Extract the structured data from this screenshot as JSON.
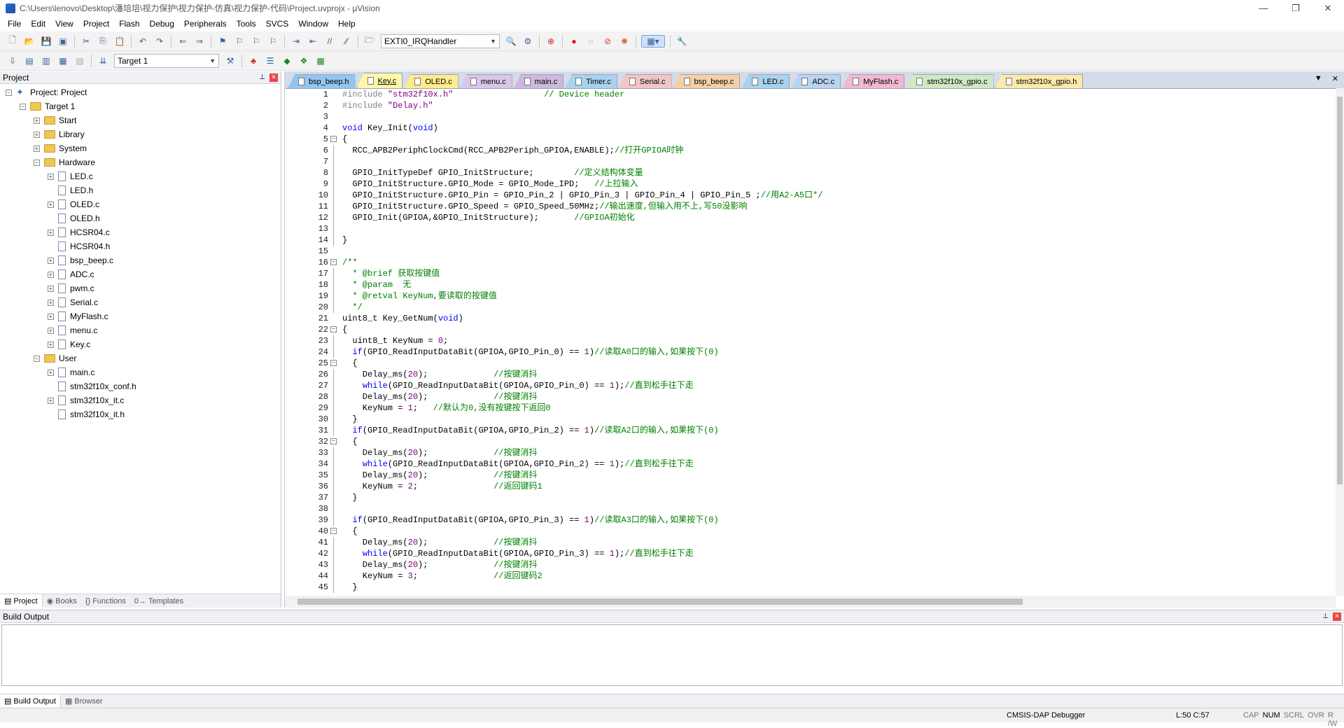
{
  "window": {
    "title": "C:\\Users\\lenovo\\Desktop\\潘培培\\视力保护\\视力保护-仿真\\视力保护-代码\\Project.uvprojx - µVision"
  },
  "menu": [
    "File",
    "Edit",
    "View",
    "Project",
    "Flash",
    "Debug",
    "Peripherals",
    "Tools",
    "SVCS",
    "Window",
    "Help"
  ],
  "toolbar": {
    "function_combo": "EXTI0_IRQHandler",
    "target_combo": "Target 1"
  },
  "project_panel": {
    "title": "Project",
    "root": "Project: Project",
    "target": "Target 1",
    "groups": [
      {
        "name": "Start",
        "files": []
      },
      {
        "name": "Library",
        "files": []
      },
      {
        "name": "System",
        "files": []
      },
      {
        "name": "Hardware",
        "files": [
          {
            "name": "LED.c",
            "expandable": true
          },
          {
            "name": "LED.h",
            "expandable": false
          },
          {
            "name": "OLED.c",
            "expandable": true
          },
          {
            "name": "OLED.h",
            "expandable": false
          },
          {
            "name": "HCSR04.c",
            "expandable": true
          },
          {
            "name": "HCSR04.h",
            "expandable": false
          },
          {
            "name": "bsp_beep.c",
            "expandable": true
          },
          {
            "name": "ADC.c",
            "expandable": true
          },
          {
            "name": "pwm.c",
            "expandable": true
          },
          {
            "name": "Serial.c",
            "expandable": true
          },
          {
            "name": "MyFlash.c",
            "expandable": true
          },
          {
            "name": "menu.c",
            "expandable": true
          },
          {
            "name": "Key.c",
            "expandable": true
          }
        ]
      },
      {
        "name": "User",
        "files": [
          {
            "name": "main.c",
            "expandable": true
          },
          {
            "name": "stm32f10x_conf.h",
            "expandable": false
          },
          {
            "name": "stm32f10x_it.c",
            "expandable": true
          },
          {
            "name": "stm32f10x_it.h",
            "expandable": false
          }
        ]
      }
    ],
    "tabs": [
      "Project",
      "Books",
      "Functions",
      "Templates"
    ]
  },
  "editor": {
    "tabs": [
      {
        "label": "bsp_beep.h",
        "color": "#93c6ec",
        "active": false
      },
      {
        "label": "Key.c",
        "color": "#fff7a8",
        "active": true
      },
      {
        "label": "OLED.c",
        "color": "#ffec8c",
        "active": false
      },
      {
        "label": "menu.c",
        "color": "#d8c7e8",
        "active": false
      },
      {
        "label": "main.c",
        "color": "#cdb8de",
        "active": false
      },
      {
        "label": "Timer.c",
        "color": "#a9d2ee",
        "active": false
      },
      {
        "label": "Serial.c",
        "color": "#f2c6c6",
        "active": false
      },
      {
        "label": "bsp_beep.c",
        "color": "#f6cfa3",
        "active": false
      },
      {
        "label": "LED.c",
        "color": "#a9d2ee",
        "active": false
      },
      {
        "label": "ADC.c",
        "color": "#b9d3f2",
        "active": false
      },
      {
        "label": "MyFlash.c",
        "color": "#f2b8cf",
        "active": false
      },
      {
        "label": "stm32f10x_gpio.c",
        "color": "#cfe9c2",
        "active": false
      },
      {
        "label": "stm32f10x_gpio.h",
        "color": "#fde9a8",
        "active": false
      }
    ],
    "lines": [
      {
        "n": "1",
        "fold": "",
        "t": [
          [
            "pp",
            "#include "
          ],
          [
            "st",
            "\"stm32f10x.h\""
          ],
          [
            "",
            "                  "
          ],
          [
            "cm",
            "// Device header"
          ]
        ]
      },
      {
        "n": "2",
        "fold": "",
        "t": [
          [
            "pp",
            "#include "
          ],
          [
            "st",
            "\"Delay.h\""
          ]
        ]
      },
      {
        "n": "3",
        "fold": "",
        "t": []
      },
      {
        "n": "4",
        "fold": "",
        "t": [
          [
            "kw",
            "void"
          ],
          [
            "",
            " Key_Init("
          ],
          [
            "kw",
            "void"
          ],
          [
            "",
            ")"
          ]
        ]
      },
      {
        "n": "5",
        "fold": "box",
        "t": [
          [
            "",
            "{"
          ]
        ]
      },
      {
        "n": "6",
        "fold": "line",
        "t": [
          [
            "",
            "  RCC_APB2PeriphClockCmd(RCC_APB2Periph_GPIOA,ENABLE);"
          ],
          [
            "cm",
            "//打开GPIOA时钟"
          ]
        ]
      },
      {
        "n": "7",
        "fold": "line",
        "t": []
      },
      {
        "n": "8",
        "fold": "line",
        "t": [
          [
            "",
            "  GPIO_InitTypeDef GPIO_InitStructure;        "
          ],
          [
            "cm",
            "//定义结构体变量"
          ]
        ]
      },
      {
        "n": "9",
        "fold": "line",
        "t": [
          [
            "",
            "  GPIO_InitStructure.GPIO_Mode = GPIO_Mode_IPD;   "
          ],
          [
            "cm",
            "//上拉输入"
          ]
        ]
      },
      {
        "n": "10",
        "fold": "line",
        "t": [
          [
            "",
            "  GPIO_InitStructure.GPIO_Pin = GPIO_Pin_2 | GPIO_Pin_3 | GPIO_Pin_4 | GPIO_Pin_5 ;"
          ],
          [
            "cm",
            "//用A2-A5口*/"
          ]
        ]
      },
      {
        "n": "11",
        "fold": "line",
        "t": [
          [
            "",
            "  GPIO_InitStructure.GPIO_Speed = GPIO_Speed_50MHz;"
          ],
          [
            "cm",
            "//输出速度,但输入用不上,写50没影响"
          ]
        ]
      },
      {
        "n": "12",
        "fold": "line",
        "t": [
          [
            "",
            "  GPIO_Init(GPIOA,&GPIO_InitStructure);       "
          ],
          [
            "cm",
            "//GPIOA初始化"
          ]
        ]
      },
      {
        "n": "13",
        "fold": "line",
        "t": []
      },
      {
        "n": "14",
        "fold": "line",
        "t": [
          [
            "",
            "}"
          ]
        ]
      },
      {
        "n": "15",
        "fold": "",
        "t": []
      },
      {
        "n": "16",
        "fold": "box",
        "t": [
          [
            "cm",
            "/**"
          ]
        ]
      },
      {
        "n": "17",
        "fold": "line",
        "t": [
          [
            "cm",
            "  * @brief 获取按键值"
          ]
        ]
      },
      {
        "n": "18",
        "fold": "line",
        "t": [
          [
            "cm",
            "  * @param  无"
          ]
        ]
      },
      {
        "n": "19",
        "fold": "line",
        "t": [
          [
            "cm",
            "  * @retval KeyNum,要读取的按键值"
          ]
        ]
      },
      {
        "n": "20",
        "fold": "line",
        "t": [
          [
            "cm",
            "  */"
          ]
        ]
      },
      {
        "n": "21",
        "fold": "",
        "t": [
          [
            "",
            "uint8_t Key_GetNum("
          ],
          [
            "kw",
            "void"
          ],
          [
            "",
            ")"
          ]
        ]
      },
      {
        "n": "22",
        "fold": "box",
        "t": [
          [
            "",
            "{"
          ]
        ]
      },
      {
        "n": "23",
        "fold": "line",
        "t": [
          [
            "",
            "  uint8_t KeyNum = "
          ],
          [
            "nm",
            "0"
          ],
          [
            "",
            ";"
          ]
        ]
      },
      {
        "n": "24",
        "fold": "line",
        "t": [
          [
            "",
            "  "
          ],
          [
            "kw",
            "if"
          ],
          [
            "",
            "(GPIO_ReadInputDataBit(GPIOA,GPIO_Pin_0) == "
          ],
          [
            "nm",
            "1"
          ],
          [
            "",
            ")"
          ],
          [
            "cm",
            "//读取A0口的输入,如果按下(0)"
          ]
        ]
      },
      {
        "n": "25",
        "fold": "box",
        "t": [
          [
            "",
            "  {"
          ]
        ]
      },
      {
        "n": "26",
        "fold": "line",
        "t": [
          [
            "",
            "    Delay_ms("
          ],
          [
            "nm",
            "20"
          ],
          [
            "",
            ");             "
          ],
          [
            "cm",
            "//按键消抖"
          ]
        ]
      },
      {
        "n": "27",
        "fold": "line",
        "t": [
          [
            "",
            "    "
          ],
          [
            "kw",
            "while"
          ],
          [
            "",
            "(GPIO_ReadInputDataBit(GPIOA,GPIO_Pin_0) == "
          ],
          [
            "nm",
            "1"
          ],
          [
            "",
            ");"
          ],
          [
            "cm",
            "//直到松手往下走"
          ]
        ]
      },
      {
        "n": "28",
        "fold": "line",
        "t": [
          [
            "",
            "    Delay_ms("
          ],
          [
            "nm",
            "20"
          ],
          [
            "",
            ");             "
          ],
          [
            "cm",
            "//按键消抖"
          ]
        ]
      },
      {
        "n": "29",
        "fold": "line",
        "t": [
          [
            "",
            "    KeyNum = "
          ],
          [
            "nm",
            "1"
          ],
          [
            "",
            ";   "
          ],
          [
            "cm",
            "//默认为0,没有按键按下返回0"
          ]
        ]
      },
      {
        "n": "30",
        "fold": "line",
        "t": [
          [
            "",
            "  }"
          ]
        ]
      },
      {
        "n": "31",
        "fold": "line",
        "t": [
          [
            "",
            "  "
          ],
          [
            "kw",
            "if"
          ],
          [
            "",
            "(GPIO_ReadInputDataBit(GPIOA,GPIO_Pin_2) == "
          ],
          [
            "nm",
            "1"
          ],
          [
            "",
            ")"
          ],
          [
            "cm",
            "//读取A2口的输入,如果按下(0)"
          ]
        ]
      },
      {
        "n": "32",
        "fold": "box",
        "t": [
          [
            "",
            "  {"
          ]
        ]
      },
      {
        "n": "33",
        "fold": "line",
        "t": [
          [
            "",
            "    Delay_ms("
          ],
          [
            "nm",
            "20"
          ],
          [
            "",
            ");             "
          ],
          [
            "cm",
            "//按键消抖"
          ]
        ]
      },
      {
        "n": "34",
        "fold": "line",
        "t": [
          [
            "",
            "    "
          ],
          [
            "kw",
            "while"
          ],
          [
            "",
            "(GPIO_ReadInputDataBit(GPIOA,GPIO_Pin_2) == "
          ],
          [
            "nm",
            "1"
          ],
          [
            "",
            ");"
          ],
          [
            "cm",
            "//直到松手往下走"
          ]
        ]
      },
      {
        "n": "35",
        "fold": "line",
        "t": [
          [
            "",
            "    Delay_ms("
          ],
          [
            "nm",
            "20"
          ],
          [
            "",
            ");             "
          ],
          [
            "cm",
            "//按键消抖"
          ]
        ]
      },
      {
        "n": "36",
        "fold": "line",
        "t": [
          [
            "",
            "    KeyNum = "
          ],
          [
            "nm",
            "2"
          ],
          [
            "",
            ";               "
          ],
          [
            "cm",
            "//返回键码1"
          ]
        ]
      },
      {
        "n": "37",
        "fold": "line",
        "t": [
          [
            "",
            "  }"
          ]
        ]
      },
      {
        "n": "38",
        "fold": "line",
        "t": []
      },
      {
        "n": "39",
        "fold": "line",
        "t": [
          [
            "",
            "  "
          ],
          [
            "kw",
            "if"
          ],
          [
            "",
            "(GPIO_ReadInputDataBit(GPIOA,GPIO_Pin_3) == "
          ],
          [
            "nm",
            "1"
          ],
          [
            "",
            ")"
          ],
          [
            "cm",
            "//读取A3口的输入,如果按下(0)"
          ]
        ]
      },
      {
        "n": "40",
        "fold": "box",
        "t": [
          [
            "",
            "  {"
          ]
        ]
      },
      {
        "n": "41",
        "fold": "line",
        "t": [
          [
            "",
            "    Delay_ms("
          ],
          [
            "nm",
            "20"
          ],
          [
            "",
            ");             "
          ],
          [
            "cm",
            "//按键消抖"
          ]
        ]
      },
      {
        "n": "42",
        "fold": "line",
        "t": [
          [
            "",
            "    "
          ],
          [
            "kw",
            "while"
          ],
          [
            "",
            "(GPIO_ReadInputDataBit(GPIOA,GPIO_Pin_3) == "
          ],
          [
            "nm",
            "1"
          ],
          [
            "",
            ");"
          ],
          [
            "cm",
            "//直到松手往下走"
          ]
        ]
      },
      {
        "n": "43",
        "fold": "line",
        "t": [
          [
            "",
            "    Delay_ms("
          ],
          [
            "nm",
            "20"
          ],
          [
            "",
            ");             "
          ],
          [
            "cm",
            "//按键消抖"
          ]
        ]
      },
      {
        "n": "44",
        "fold": "line",
        "t": [
          [
            "",
            "    KeyNum = "
          ],
          [
            "nm",
            "3"
          ],
          [
            "",
            ";               "
          ],
          [
            "cm",
            "//返回键码2"
          ]
        ]
      },
      {
        "n": "45",
        "fold": "line",
        "t": [
          [
            "",
            "  }"
          ]
        ]
      }
    ]
  },
  "build_output": {
    "title": "Build Output",
    "tabs": [
      "Build Output",
      "Browser"
    ]
  },
  "status": {
    "debugger": "CMSIS-DAP Debugger",
    "position": "L:50 C:57",
    "indicators": [
      "CAP",
      "NUM",
      "SCRL",
      "OVR",
      "R /W"
    ]
  }
}
